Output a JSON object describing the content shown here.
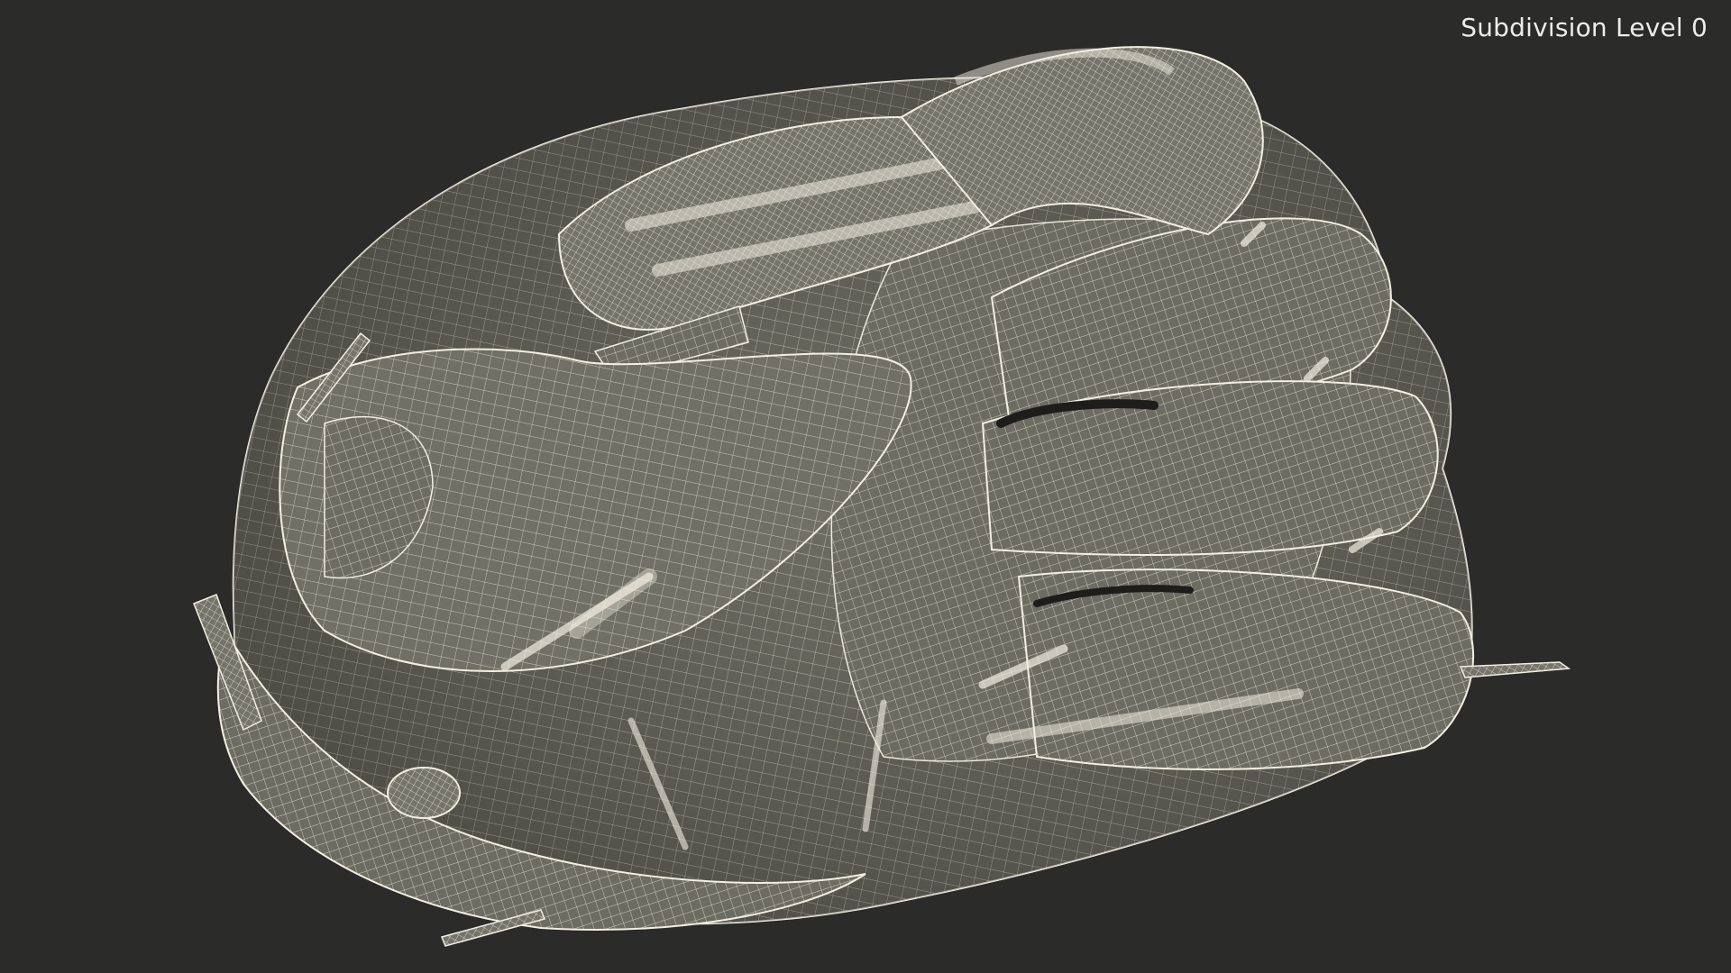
{
  "viewport": {
    "label": "Subdivision Level 0",
    "background_color": "#2b2b2a",
    "wire_color": "#f2efe2",
    "surface_color": "#6e6e64"
  },
  "model": {
    "subject": "baseball-glove-wireframe"
  }
}
